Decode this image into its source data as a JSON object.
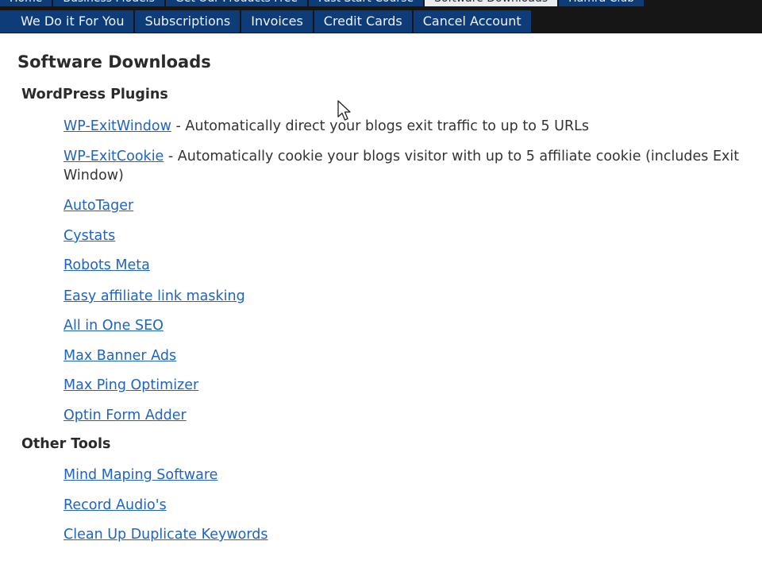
{
  "nav": {
    "row1": [
      {
        "label": "Home",
        "active": false
      },
      {
        "label": "Business Models",
        "active": false
      },
      {
        "label": "Get Our Products Free",
        "active": false
      },
      {
        "label": "Fast Start Course",
        "active": false
      },
      {
        "label": "Software Downloads",
        "active": true
      },
      {
        "label": "Hamra Club",
        "active": false
      }
    ],
    "row2": [
      {
        "label": "We Do it For You"
      },
      {
        "label": "Subscriptions"
      },
      {
        "label": "Invoices"
      },
      {
        "label": "Credit Cards"
      },
      {
        "label": "Cancel Account"
      }
    ]
  },
  "page": {
    "title": "Software Downloads"
  },
  "sections": {
    "wordpress": {
      "title": "WordPress Plugins",
      "items": [
        {
          "link": "WP-ExitWindow",
          "desc": " - Automatically direct your blogs exit traffic to up to 5 URLs"
        },
        {
          "link": "WP-ExitCookie",
          "desc": " - Automatically cookie your blogs visitor with up to 5 affiliate cookie (includes Exit Window)"
        },
        {
          "link": "AutoTager"
        },
        {
          "link": "Cystats"
        },
        {
          "link": "Robots Meta"
        },
        {
          "link": "Easy affiliate link masking"
        },
        {
          "link": "All in One SEO"
        },
        {
          "link": "Max Banner Ads"
        },
        {
          "link": "Max Ping Optimizer"
        },
        {
          "link": "Optin Form Adder"
        }
      ]
    },
    "other": {
      "title": "Other Tools",
      "items": [
        {
          "link": "Mind Maping Software"
        },
        {
          "link": "Record Audio's"
        },
        {
          "link": "Clean Up Duplicate Keywords"
        }
      ]
    }
  },
  "colors": {
    "nav_bg": "#0d3c78",
    "topbar_bg": "#161616",
    "link": "#1f63c6"
  },
  "icons": {
    "cursor": "mouse-pointer-icon"
  }
}
